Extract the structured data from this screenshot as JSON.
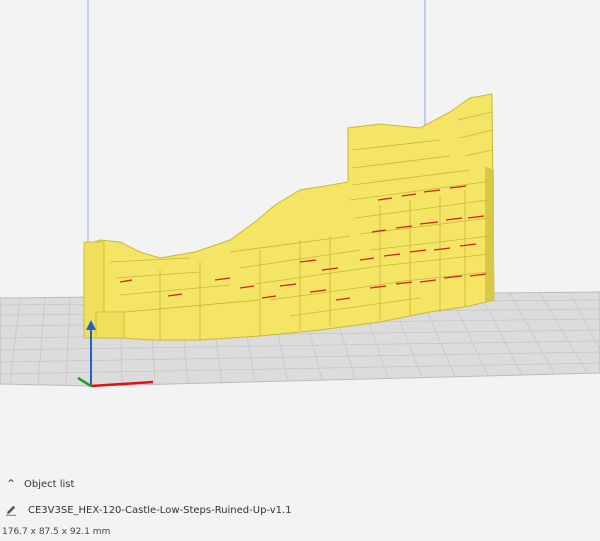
{
  "object_list": {
    "toggle_icon": "chevron-up-icon",
    "label": "Object list"
  },
  "object": {
    "edit_icon": "pencil-icon",
    "name": "CE3V3SE_HEX-120-Castle-Low-Steps-Ruined-Up-v1.1",
    "dimensions": "176.7 x 87.5 x 92.1 mm"
  },
  "colors": {
    "background": "#f3f3f3",
    "build_plate": "#dcdcdc",
    "grid_line": "#bcbcbc",
    "model": "#f4e564",
    "model_shadow": "#c8b83a",
    "overhang": "#d42020",
    "axis_x": "#e01010",
    "axis_y": "#2060d0",
    "axis_z": "#10a020"
  }
}
